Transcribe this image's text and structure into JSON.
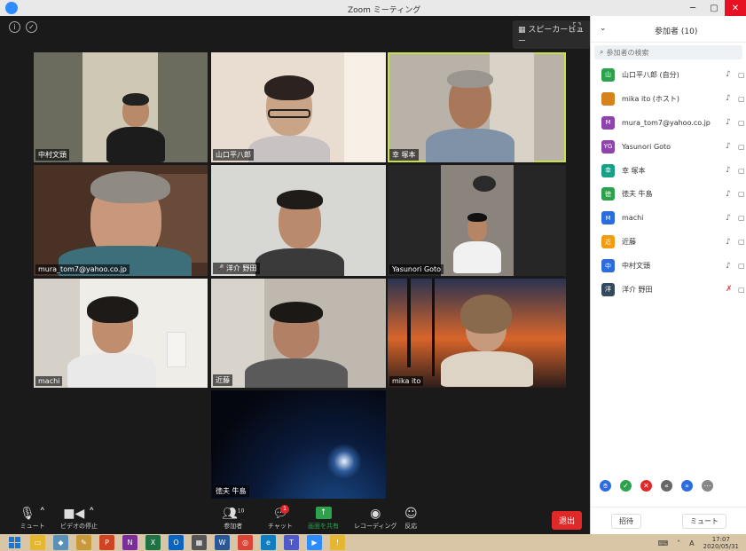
{
  "window": {
    "title": "Zoom ミーティング"
  },
  "stage": {
    "speaker_view_label": "スピーカービュー",
    "tiles": [
      {
        "name": "中村文頭",
        "muted": false,
        "active": false
      },
      {
        "name": "山口平八郎",
        "muted": false,
        "active": false
      },
      {
        "name": "幸 塚本",
        "muted": false,
        "active": true
      },
      {
        "name": "mura_tom7@yahoo.co.jp",
        "muted": false,
        "active": false
      },
      {
        "name": "洋介 野田",
        "muted": true,
        "active": false
      },
      {
        "name": "Yasunori Goto",
        "muted": false,
        "active": false
      },
      {
        "name": "machi",
        "muted": false,
        "active": false
      },
      {
        "name": "近藤",
        "muted": false,
        "active": false
      },
      {
        "name": "mika ito",
        "muted": false,
        "active": false
      },
      {
        "name": "徳夫 牛島",
        "muted": false,
        "active": false
      }
    ]
  },
  "toolbar": {
    "mute_label": "ミュート",
    "video_label": "ビデオの停止",
    "participants_label": "参加者",
    "participants_count": "10",
    "chat_label": "チャット",
    "chat_badge": "1",
    "share_label": "画面を共有",
    "record_label": "レコーディング",
    "reactions_label": "反応",
    "leave_label": "退出"
  },
  "panel": {
    "title": "参加者 (10)",
    "search_placeholder": "参加者の検索",
    "participants": [
      {
        "initial": "山",
        "name": "山口平八郎 (自分)",
        "color": "#2da24c",
        "mic_off": false
      },
      {
        "initial": "",
        "name": "mika ito (ホスト)",
        "color": "#d4821a",
        "mic_off": false
      },
      {
        "initial": "M",
        "name": "mura_tom7@yahoo.co.jp",
        "color": "#8e44ad",
        "mic_off": false
      },
      {
        "initial": "YG",
        "name": "Yasunori Goto",
        "color": "#8e44ad",
        "mic_off": false
      },
      {
        "initial": "幸",
        "name": "幸 塚本",
        "color": "#16a085",
        "mic_off": false
      },
      {
        "initial": "徳",
        "name": "徳夫 牛島",
        "color": "#2da24c",
        "mic_off": false
      },
      {
        "initial": "M",
        "name": "machi",
        "color": "#2d6cdf",
        "mic_off": false
      },
      {
        "initial": "近",
        "name": "近藤",
        "color": "#f39c12",
        "mic_off": false
      },
      {
        "initial": "中",
        "name": "中村文頭",
        "color": "#2d6cdf",
        "mic_off": false
      },
      {
        "initial": "洋",
        "name": "洋介 野田",
        "color": "#34495e",
        "mic_off": true
      }
    ],
    "invite_label": "招待",
    "mute_all_label": "ミュート"
  },
  "taskbar": {
    "time": "17:07",
    "date": "2020/05/31",
    "ime": "A"
  }
}
